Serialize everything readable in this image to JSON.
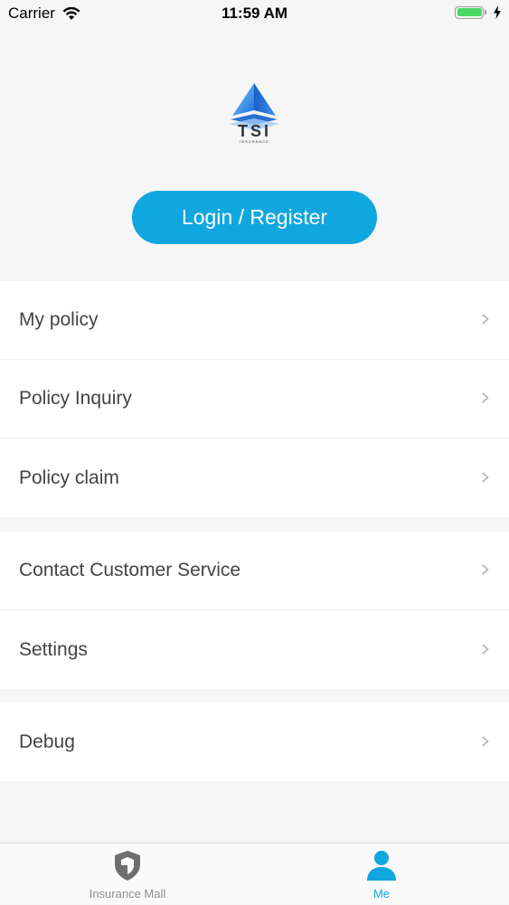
{
  "status_bar": {
    "carrier": "Carrier",
    "time": "11:59 AM"
  },
  "header": {
    "logo_text": "TSI",
    "logo_subtext": "INSURANCE",
    "login_label": "Login / Register"
  },
  "menu": {
    "group1": [
      {
        "label": "My policy"
      },
      {
        "label": "Policy Inquiry"
      },
      {
        "label": "Policy claim"
      }
    ],
    "group2": [
      {
        "label": "Contact Customer Service"
      },
      {
        "label": "Settings"
      }
    ],
    "group3": [
      {
        "label": "Debug"
      }
    ]
  },
  "tab_bar": {
    "tabs": [
      {
        "label": "Insurance Mall",
        "icon": "shield-icon",
        "active": false
      },
      {
        "label": "Me",
        "icon": "person-icon",
        "active": true
      }
    ]
  },
  "colors": {
    "accent": "#10a7df",
    "inactive": "#8e8e8e",
    "battery": "#4cd964"
  }
}
